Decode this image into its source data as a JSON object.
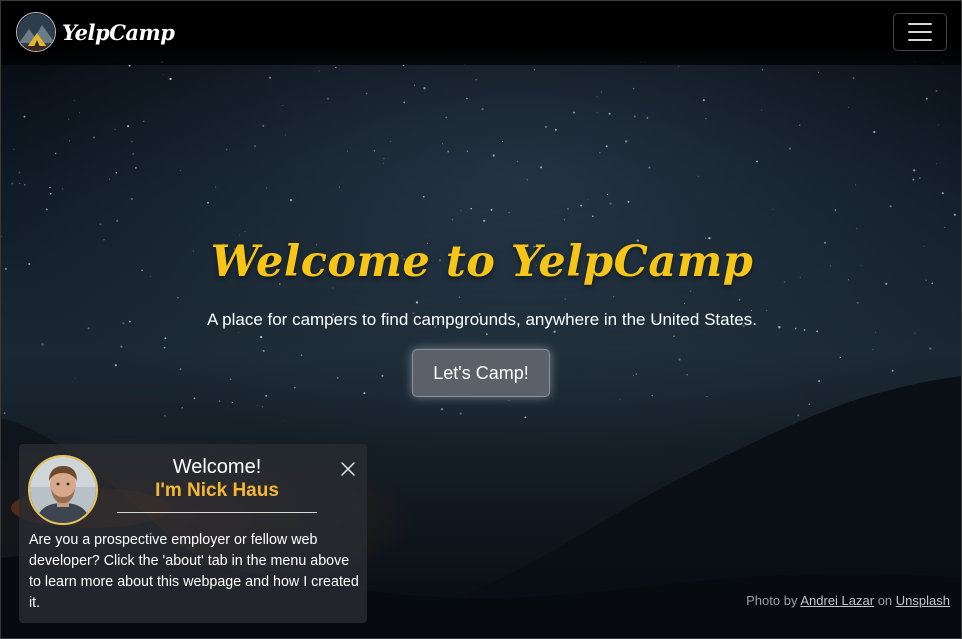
{
  "navbar": {
    "brand_name": "YelpCamp",
    "menu_toggle_icon": "hamburger-menu-icon"
  },
  "hero": {
    "title": "Welcome to YelpCamp",
    "subtitle": "A place for campers to find campgrounds, anywhere in the United States.",
    "cta_label": "Let's Camp!"
  },
  "welcome_card": {
    "heading": "Welcome!",
    "name": "I'm Nick Haus",
    "body": "Are you a prospective employer or fellow web developer? Click the 'about' tab in the menu above to learn more about this webpage and how I created it.",
    "close_icon": "close-icon"
  },
  "credit": {
    "prefix": "Photo by",
    "author": "Andrei Lazar",
    "middle": "on",
    "site": "Unsplash"
  },
  "colors": {
    "accent_yellow": "#f5c518",
    "name_orange": "#f5b733",
    "button_gray": "#5b6169"
  }
}
